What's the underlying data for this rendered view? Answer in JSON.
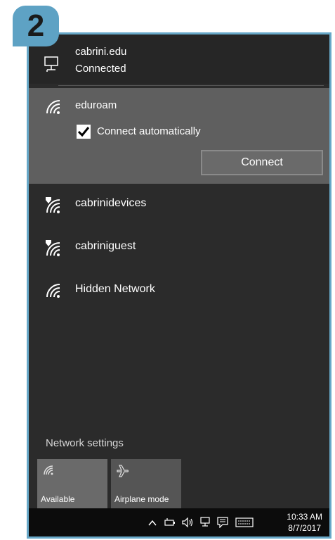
{
  "step_badge": "2",
  "current_network": {
    "name": "cabrini.edu",
    "status": "Connected",
    "icon": "wired-network-icon"
  },
  "selected_network": {
    "name": "eduroam",
    "icon": "wifi-icon",
    "connect_automatically": {
      "label": "Connect automatically",
      "checked": true
    },
    "connect_button": "Connect"
  },
  "networks": [
    {
      "name": "cabrinidevices",
      "icon": "wifi-secured-icon"
    },
    {
      "name": "cabriniguest",
      "icon": "wifi-secured-icon"
    },
    {
      "name": "Hidden Network",
      "icon": "wifi-icon"
    }
  ],
  "network_settings": "Network settings",
  "quick_actions": [
    {
      "label": "Available",
      "icon": "wifi-icon",
      "active": false
    },
    {
      "label": "Airplane mode",
      "icon": "airplane-icon",
      "active": false
    }
  ],
  "taskbar": {
    "time": "10:33 AM",
    "date": "8/7/2017",
    "icons": [
      "chevron-up-icon",
      "battery-icon",
      "volume-icon",
      "network-icon",
      "action-center-icon",
      "keyboard-icon"
    ]
  },
  "colors": {
    "panel_bg": "#2b2b2b",
    "selected_bg": "#5f5f5f",
    "taskbar_bg": "#0c0c0c",
    "frame_border": "#67a8c8",
    "badge_bg": "#5ea2c4"
  }
}
